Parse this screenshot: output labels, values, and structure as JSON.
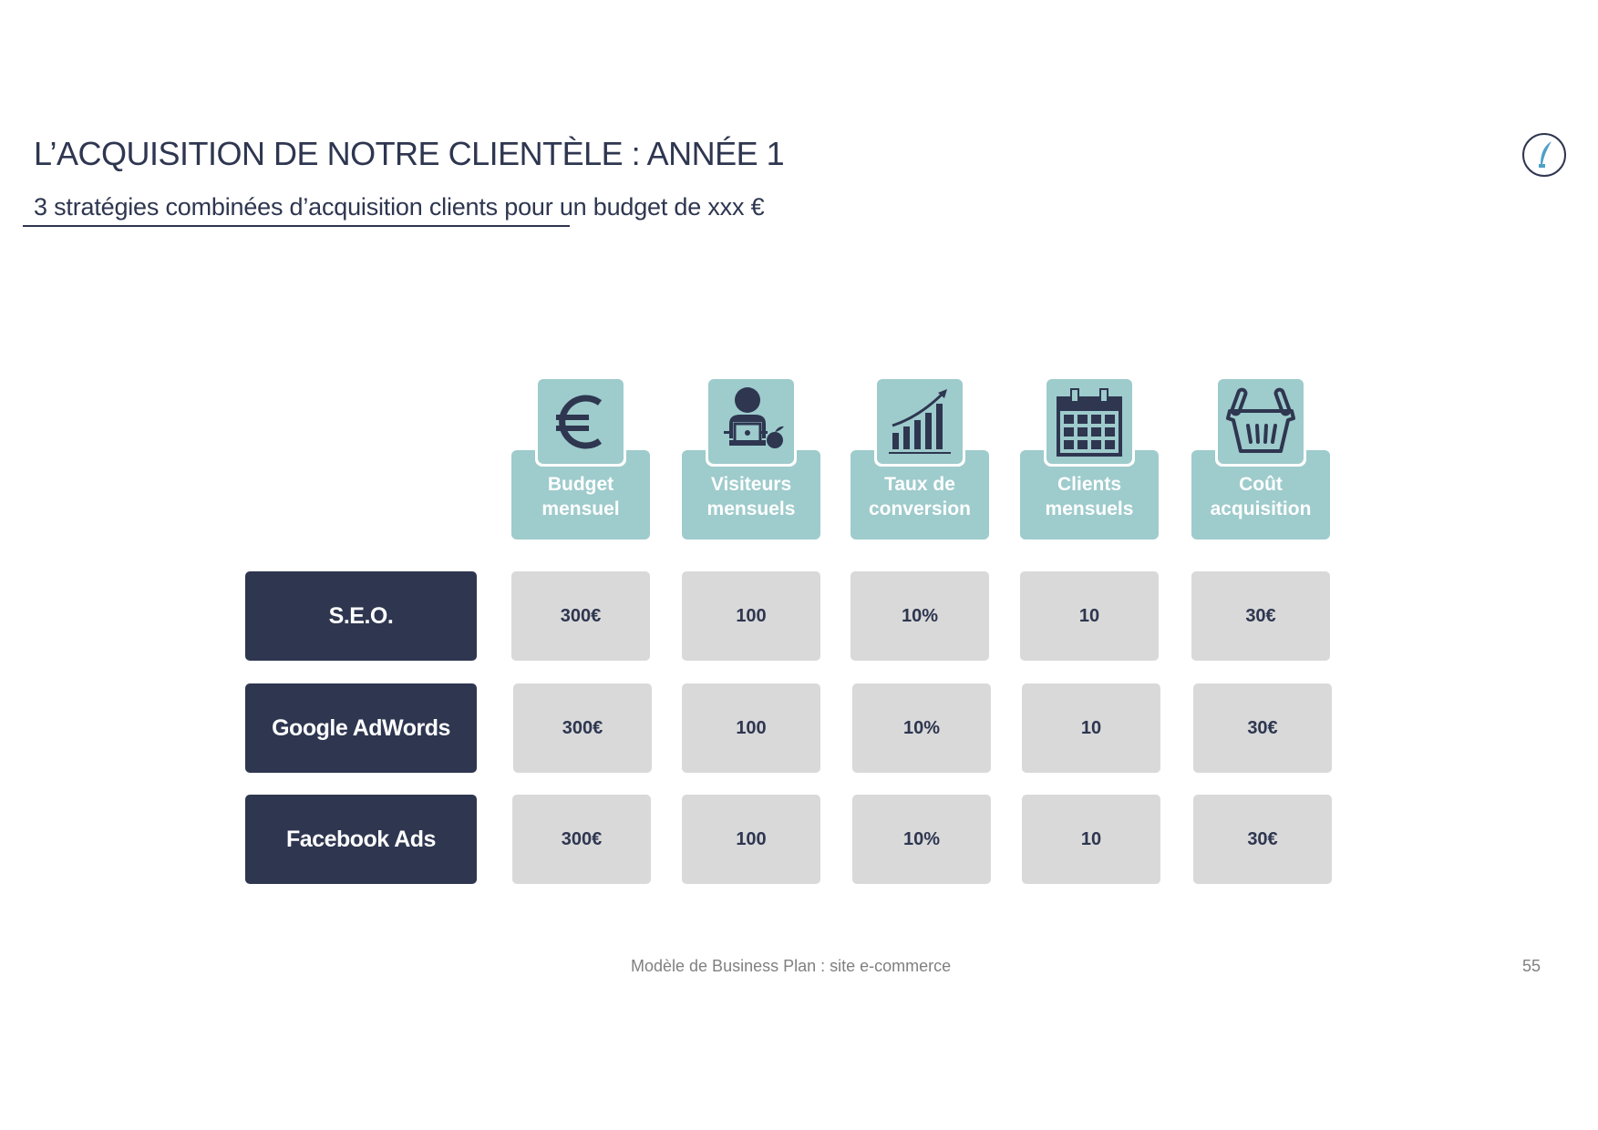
{
  "header": {
    "title": "L’ACQUISITION DE NOTRE CLIENTÈLE : ANNÉE 1",
    "subtitle": "3 stratégies combinées d’acquisition clients pour un budget de xxx €",
    "logo_icon": "quill-pen-icon"
  },
  "colors": {
    "navy": "#2e3650",
    "teal": "#9ecbcc",
    "cell_gray": "#d9d9d9",
    "footer_gray": "#808080"
  },
  "table": {
    "columns": [
      {
        "label_line1": "Budget",
        "label_line2": "mensuel",
        "icon": "euro-icon"
      },
      {
        "label_line1": "Visiteurs",
        "label_line2": "mensuels",
        "icon": "person-laptop-icon"
      },
      {
        "label_line1": "Taux de",
        "label_line2": "conversion",
        "icon": "growth-chart-icon"
      },
      {
        "label_line1": "Clients",
        "label_line2": "mensuels",
        "icon": "calendar-icon"
      },
      {
        "label_line1": "Coût",
        "label_line2": "acquisition",
        "icon": "shopping-basket-icon"
      }
    ],
    "rows": [
      {
        "label": "S.E.O.",
        "values": [
          "300€",
          "100",
          "10%",
          "10",
          "30€"
        ]
      },
      {
        "label": "Google AdWords",
        "values": [
          "300€",
          "100",
          "10%",
          "10",
          "30€"
        ]
      },
      {
        "label": "Facebook Ads",
        "values": [
          "300€",
          "100",
          "10%",
          "10",
          "30€"
        ]
      }
    ]
  },
  "footer": {
    "text": "Modèle de Business Plan : site e-commerce",
    "page_number": "55"
  }
}
